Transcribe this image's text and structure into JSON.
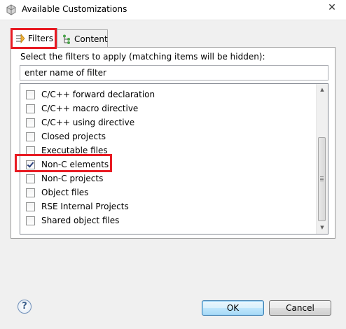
{
  "window": {
    "title": "Available Customizations",
    "close_glyph": "✕"
  },
  "tabs": [
    {
      "label": "Filters",
      "icon": "filter-icon",
      "selected": true
    },
    {
      "label": "Content",
      "icon": "content-tree-icon",
      "selected": false
    }
  ],
  "filters_panel": {
    "instruction": "Select the filters to apply (matching items will be hidden):",
    "filter_input_value": "enter name of filter",
    "items": [
      {
        "label": "C/C++ forward declaration",
        "checked": false
      },
      {
        "label": "C/C++ macro directive",
        "checked": false
      },
      {
        "label": "C/C++ using directive",
        "checked": false
      },
      {
        "label": "Closed projects",
        "checked": false
      },
      {
        "label": "Executable files",
        "checked": false
      },
      {
        "label": "Non-C elements",
        "checked": true
      },
      {
        "label": "Non-C projects",
        "checked": false
      },
      {
        "label": "Object files",
        "checked": false
      },
      {
        "label": "RSE Internal Projects",
        "checked": false
      },
      {
        "label": "Shared object files",
        "checked": false
      }
    ]
  },
  "buttons": {
    "help": "?",
    "ok": "OK",
    "cancel": "Cancel"
  },
  "colors": {
    "highlight": "#e81b23",
    "window_bg": "#f0f0f0"
  }
}
